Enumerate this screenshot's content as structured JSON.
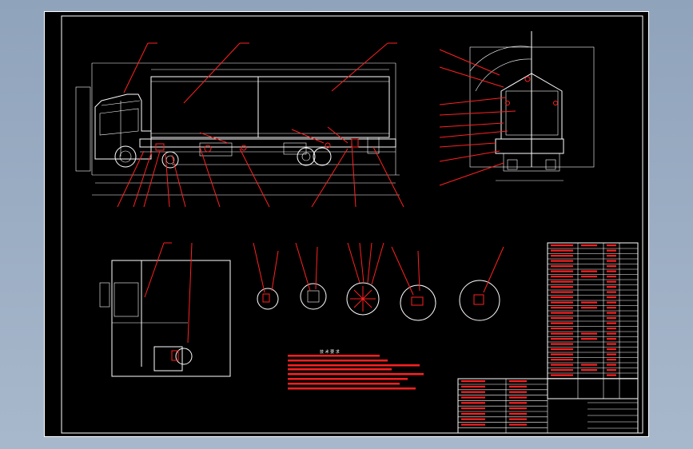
{
  "colors": {
    "background": "#9aadc3",
    "sheet": "#000000",
    "line": "#ffffff",
    "annotation": "#ff2020"
  },
  "notes": {
    "title": "技 术 要 求"
  }
}
